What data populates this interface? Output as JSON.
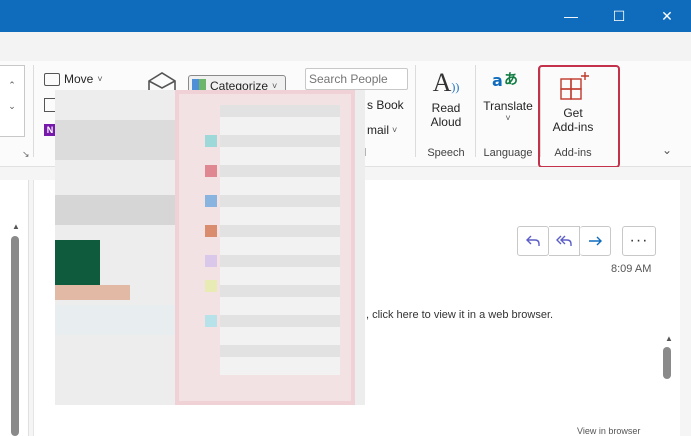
{
  "window": {
    "minimize": "—",
    "maximize": "☐",
    "close": "✕"
  },
  "ribbon": {
    "move_label": "Move",
    "categorize_label": "Categorize",
    "search_people_placeholder": "Search People",
    "address_book_partial": "s Book",
    "email_partial": "mail",
    "read_aloud_line1": "Read",
    "read_aloud_line2": "Aloud",
    "speech_group": "Speech",
    "translate_label": "Translate",
    "language_group": "Language",
    "get_addins_line1": "Get",
    "get_addins_line2": "Add-ins",
    "addins_group": "Add-ins",
    "find_group_partial": "d"
  },
  "message": {
    "time": "8:09 AM",
    "web_notice": ", click here to view it in a web browser.",
    "view_in_browser": "View in browser"
  },
  "colors": {
    "titlebar": "#0f6cbd",
    "highlight": "#c4314b",
    "reply_accent": "#5b5fc7",
    "forward_accent": "#0f6cbd"
  }
}
